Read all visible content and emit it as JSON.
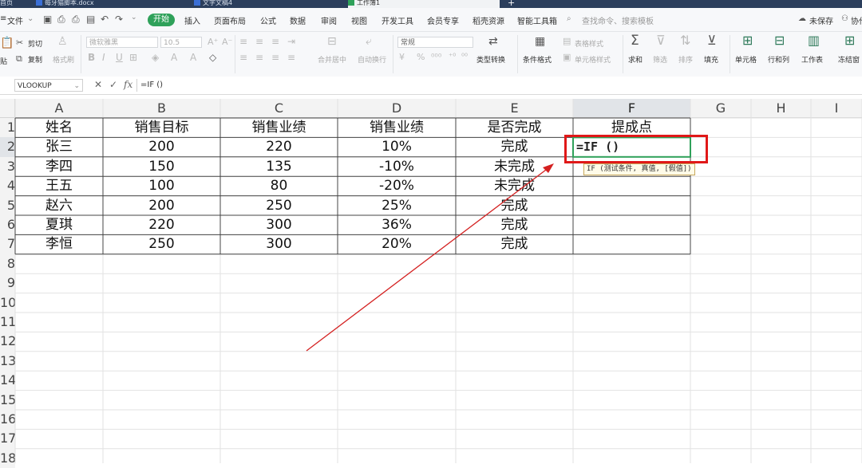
{
  "tabs": [
    {
      "label": "首页"
    },
    {
      "label": "每牙猫脚本.docx"
    },
    {
      "label": "文字文稿4"
    },
    {
      "label": "工作簿1"
    }
  ],
  "menu": {
    "file": "文件",
    "start": "开始",
    "items": [
      "插入",
      "页面布局",
      "公式",
      "数据",
      "审阅",
      "视图",
      "开发工具",
      "会员专享",
      "稻壳资源",
      "智能工具箱"
    ],
    "search_placeholder": "查找命令、搜索模板",
    "unsaved": "未保存",
    "collab": "协作"
  },
  "ribbon": {
    "paste": "贴",
    "cut": "剪切",
    "copy": "复制",
    "format_painter": "格式刷",
    "font_name": "微软雅黑",
    "font_size": "10.5",
    "merge_center": "合并居中",
    "wrap": "自动换行",
    "number_format": "常规",
    "convert": "类型转换",
    "cond_format": "条件格式",
    "table_style": "表格样式",
    "cell_style": "单元格样式",
    "sum": "求和",
    "filter": "筛选",
    "sort": "排序",
    "fill": "填充",
    "cell": "单元格",
    "rowcol": "行和列",
    "sheet": "工作表",
    "freeze": "冻结窗"
  },
  "formula_bar": {
    "name_box": "VLOOKUP",
    "fx": "fx",
    "content": "=IF ()"
  },
  "columns": [
    "A",
    "B",
    "C",
    "D",
    "E",
    "F",
    "G",
    "H",
    "I"
  ],
  "rows": [
    "1",
    "2",
    "3",
    "4",
    "5",
    "6",
    "7",
    "8",
    "9",
    "10",
    "11",
    "12",
    "13",
    "14",
    "15",
    "16",
    "17",
    "18"
  ],
  "table": {
    "headers": [
      "姓名",
      "销售目标",
      "销售业绩",
      "销售业绩",
      "是否完成",
      "提成点"
    ],
    "data": [
      [
        "张三",
        "200",
        "220",
        "10%",
        "完成"
      ],
      [
        "李四",
        "150",
        "135",
        "-10%",
        "未完成"
      ],
      [
        "王五",
        "100",
        "80",
        "-20%",
        "未完成"
      ],
      [
        "赵六",
        "200",
        "250",
        "25%",
        "完成"
      ],
      [
        "夏琪",
        "220",
        "300",
        "36%",
        "完成"
      ],
      [
        "李恒",
        "250",
        "300",
        "20%",
        "完成"
      ]
    ]
  },
  "edit_cell": "=IF ()",
  "tooltip": "IF (测试条件, 真值, [假值])",
  "colors": {
    "accent": "#2fa15a",
    "highlight": "#e01818",
    "selected_cell": "#2fa15a"
  }
}
